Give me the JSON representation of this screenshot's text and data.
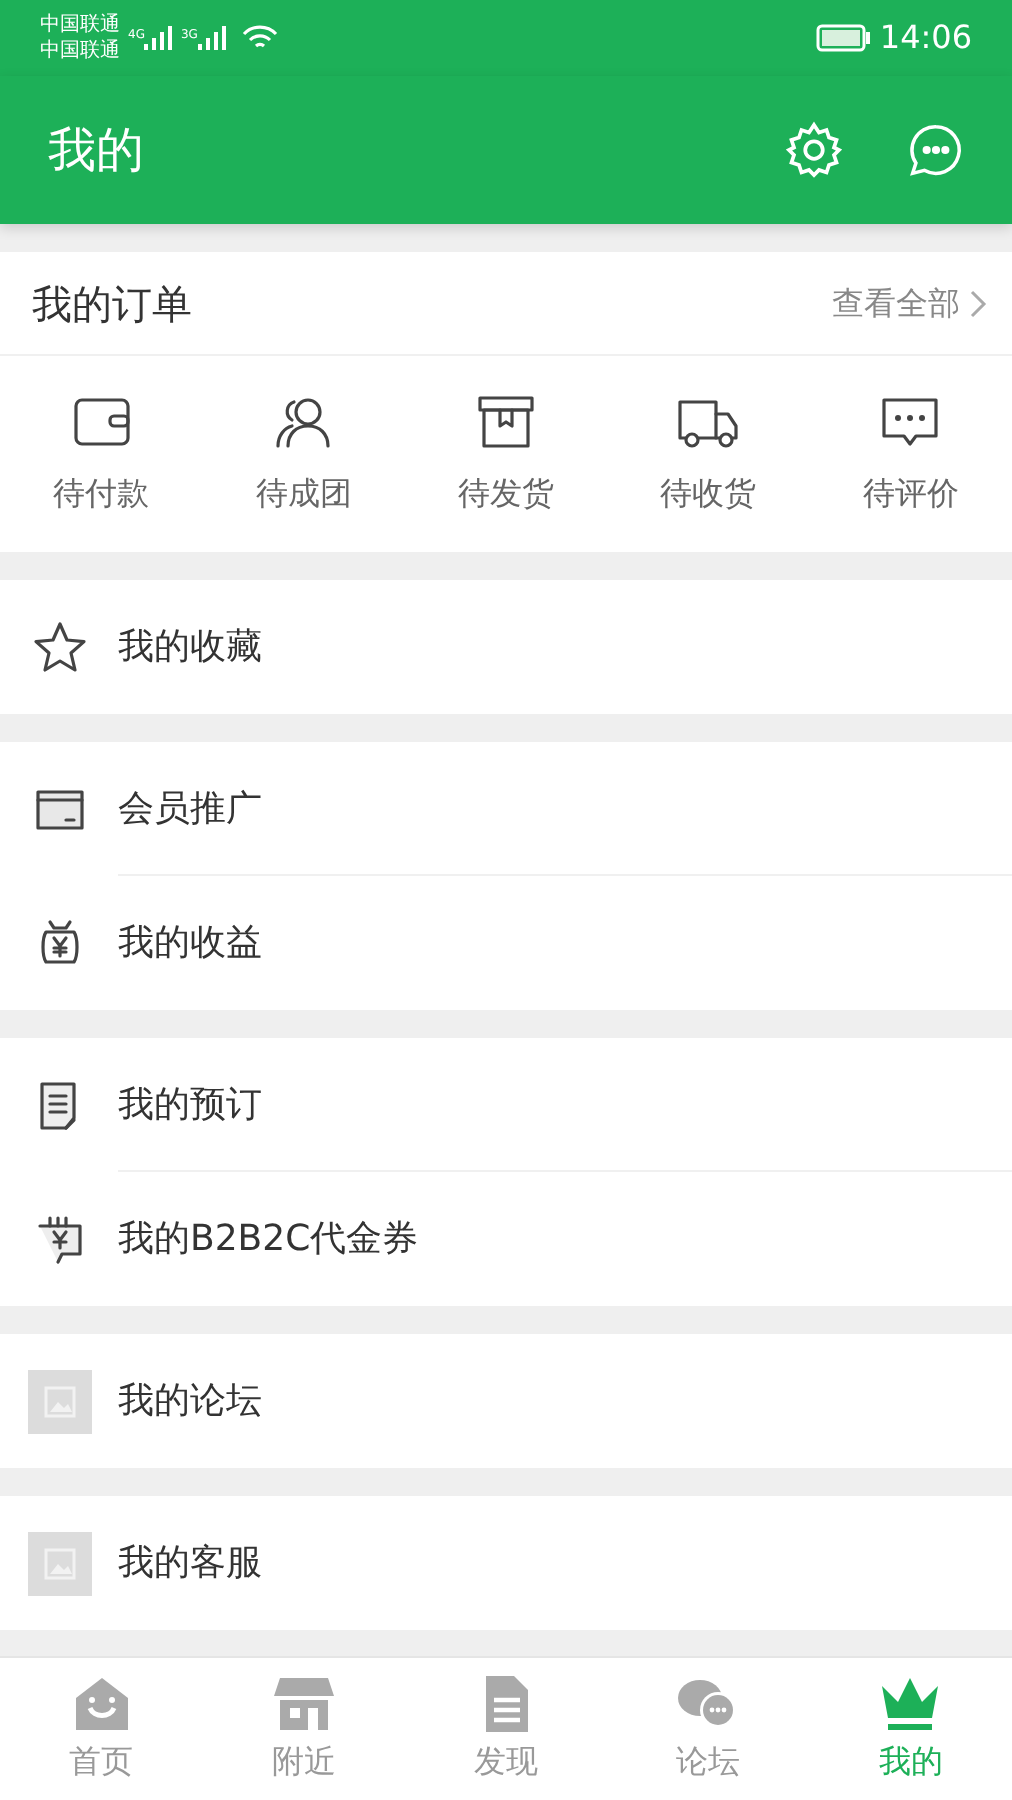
{
  "status_bar": {
    "carriers": [
      "中国联通",
      "中国联通"
    ],
    "networks": [
      "4G",
      "3G"
    ],
    "time": "14:06"
  },
  "header": {
    "title": "我的"
  },
  "orders": {
    "title": "我的订单",
    "view_all": "查看全部",
    "items": [
      {
        "label": "待付款",
        "kind": "wallet"
      },
      {
        "label": "待成团",
        "kind": "group"
      },
      {
        "label": "待发货",
        "kind": "box"
      },
      {
        "label": "待收货",
        "kind": "truck"
      },
      {
        "label": "待评价",
        "kind": "chat"
      }
    ]
  },
  "menu_groups": [
    [
      {
        "label": "我的收藏",
        "kind": "star"
      }
    ],
    [
      {
        "label": "会员推广",
        "kind": "card"
      },
      {
        "label": "我的收益",
        "kind": "moneybag"
      }
    ],
    [
      {
        "label": "我的预订",
        "kind": "document"
      },
      {
        "label": "我的B2B2C代金券",
        "kind": "coupon"
      }
    ],
    [
      {
        "label": "我的论坛",
        "kind": "placeholder"
      }
    ],
    [
      {
        "label": "我的客服",
        "kind": "placeholder"
      }
    ]
  ],
  "tab_bar": [
    {
      "label": "首页",
      "kind": "home",
      "selected": false
    },
    {
      "label": "附近",
      "kind": "shop",
      "selected": false
    },
    {
      "label": "发现",
      "kind": "page",
      "selected": false
    },
    {
      "label": "论坛",
      "kind": "bubbles",
      "selected": false
    },
    {
      "label": "我的",
      "kind": "crown",
      "selected": true
    }
  ]
}
